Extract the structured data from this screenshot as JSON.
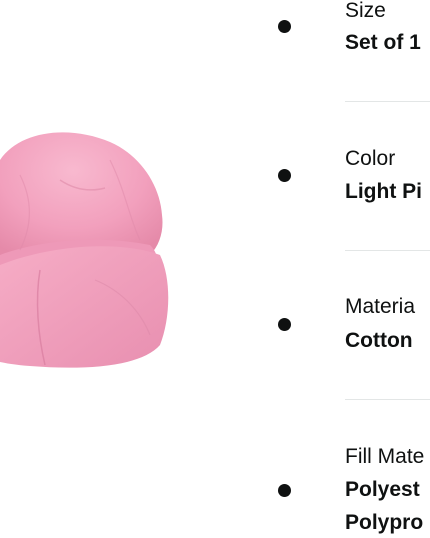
{
  "product": {
    "image_icon": "pink-bean-bag-chair",
    "image_color": "#f5a3c1"
  },
  "specs": [
    {
      "label": "Size",
      "value": "Set of 1"
    },
    {
      "label": "Color",
      "value": "Light Pi"
    },
    {
      "label": "Materia",
      "value": "Cotton"
    },
    {
      "label": "Fill Mate",
      "value_lines": [
        "Polyest",
        "Polypro"
      ]
    }
  ]
}
